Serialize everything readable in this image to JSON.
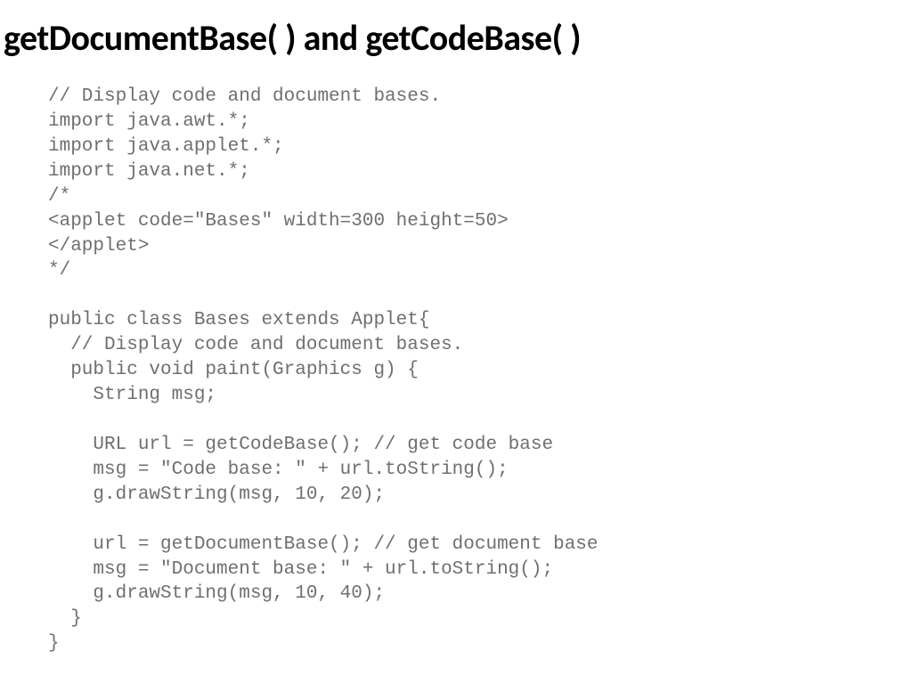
{
  "title": "getDocumentBase( ) and getCodeBase( )",
  "code": "// Display code and document bases.\nimport java.awt.*;\nimport java.applet.*;\nimport java.net.*;\n/*\n<applet code=\"Bases\" width=300 height=50>\n</applet>\n*/\n\npublic class Bases extends Applet{\n  // Display code and document bases.\n  public void paint(Graphics g) {\n    String msg;\n\n    URL url = getCodeBase(); // get code base\n    msg = \"Code base: \" + url.toString();\n    g.drawString(msg, 10, 20);\n\n    url = getDocumentBase(); // get document base\n    msg = \"Document base: \" + url.toString();\n    g.drawString(msg, 10, 40);\n  }\n}"
}
